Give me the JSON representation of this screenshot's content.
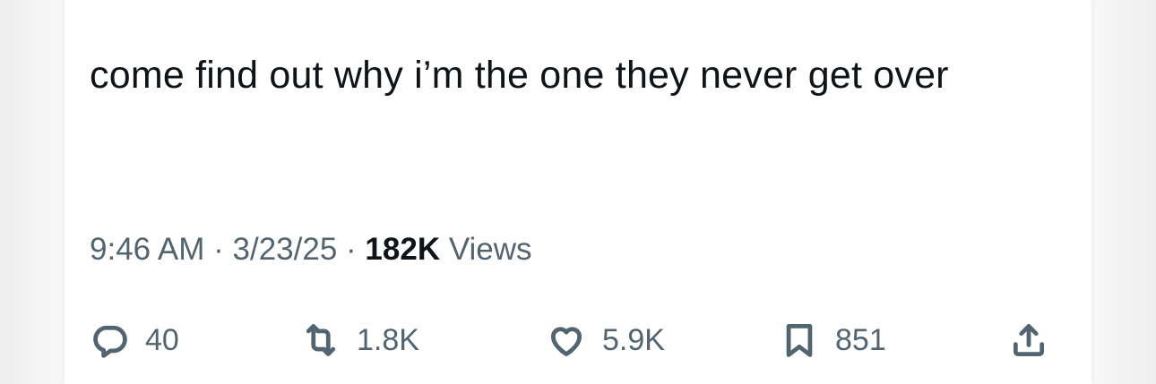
{
  "tweet": {
    "text": "come find out why i’m the one they never get over"
  },
  "meta": {
    "time": "9:46 AM",
    "separator1": " · ",
    "date": "3/23/25",
    "separator2": " · ",
    "views_count": "182K",
    "views_label": " Views"
  },
  "actions": {
    "reply": {
      "icon": "reply-bubble-icon",
      "count": "40"
    },
    "retweet": {
      "icon": "retweet-icon",
      "count": "1.8K"
    },
    "like": {
      "icon": "heart-icon",
      "count": "5.9K"
    },
    "bookmark": {
      "icon": "bookmark-icon",
      "count": "851"
    },
    "share": {
      "icon": "share-upload-icon"
    }
  },
  "colors": {
    "text_primary": "#0f1419",
    "text_secondary": "#536471",
    "card_background": "#ffffff"
  }
}
